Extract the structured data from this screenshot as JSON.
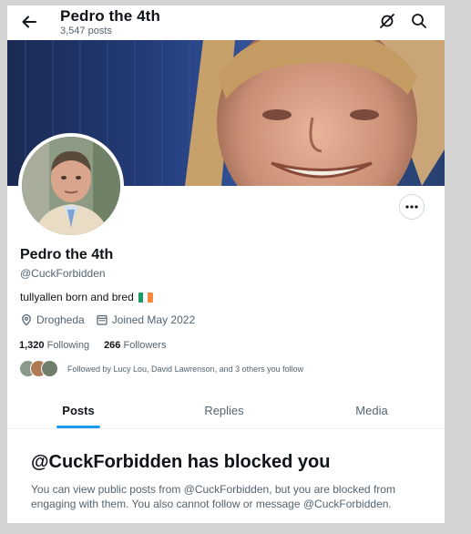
{
  "header": {
    "title": "Pedro the 4th",
    "post_count": "3,547 posts"
  },
  "profile": {
    "display_name": "Pedro the 4th",
    "handle": "@CuckForbidden",
    "bio": "tullyallen born and bred",
    "bio_flag": [
      "#169b62",
      "#ffffff",
      "#ff883e"
    ],
    "location": "Drogheda",
    "joined": "Joined May 2022",
    "following_count": "1,320",
    "following_label": "Following",
    "followers_count": "266",
    "followers_label": "Followers",
    "followed_by": "Followed by Lucy Lou, David Lawrenson, and 3 others you follow"
  },
  "tabs": [
    {
      "label": "Posts",
      "active": true
    },
    {
      "label": "Replies",
      "active": false
    },
    {
      "label": "Media",
      "active": false
    }
  ],
  "blocked": {
    "heading": "@CuckForbidden has blocked you",
    "message": "You can view public posts from @CuckForbidden, but you are blocked from engaging with them. You also cannot follow or message @CuckForbidden."
  },
  "colors": {
    "accent": "#1d9bf0",
    "text_primary": "#0f1419",
    "text_secondary": "#536471"
  },
  "icons": [
    "back-arrow-icon",
    "grok-icon",
    "search-icon",
    "more-icon",
    "location-pin-icon",
    "calendar-icon"
  ]
}
